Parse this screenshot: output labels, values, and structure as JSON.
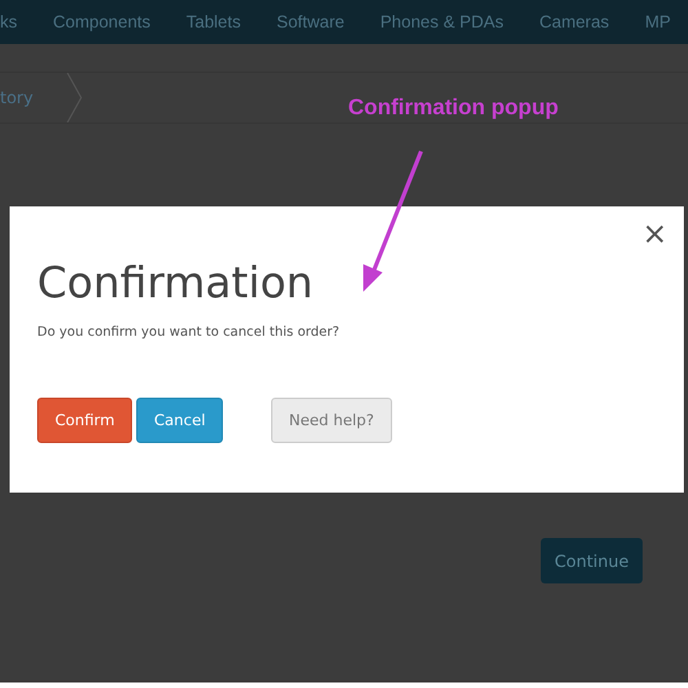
{
  "nav": {
    "items": [
      "ks",
      "Components",
      "Tablets",
      "Software",
      "Phones & PDAs",
      "Cameras",
      "MP"
    ]
  },
  "breadcrumb": {
    "items": [
      "tory"
    ]
  },
  "page": {
    "continue_button": "Continue"
  },
  "modal": {
    "title": "Confirmation",
    "message": "Do you confirm you want to cancel this order?",
    "close": "×",
    "buttons": [
      {
        "label": "Confirm",
        "kind": "danger"
      },
      {
        "label": "Cancel",
        "kind": "primary"
      },
      {
        "label": "Need help?",
        "kind": "default"
      }
    ]
  },
  "annotation": {
    "text": "Confirmation popup"
  }
}
